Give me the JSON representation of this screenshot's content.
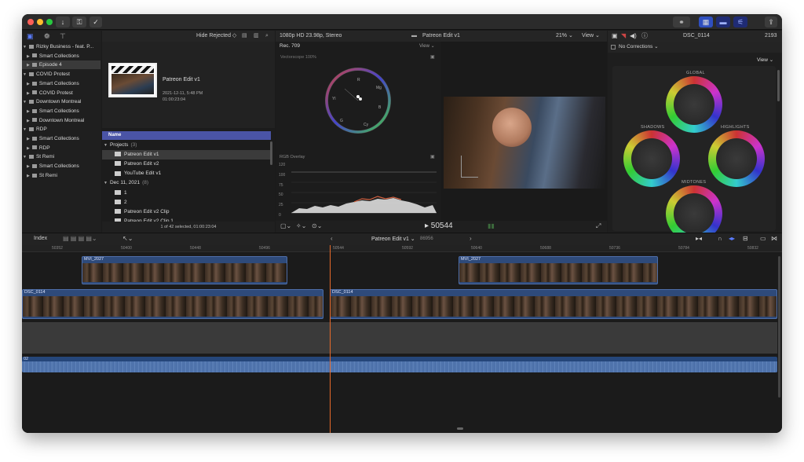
{
  "toolbar": {
    "hide_rejected": "Hide Rejected ◇"
  },
  "libraries": [
    {
      "label": "Rizky Business - feat. P...",
      "kind": "library",
      "indent": 0,
      "selected": false
    },
    {
      "label": "Smart Collections",
      "kind": "folder",
      "indent": 1,
      "selected": false
    },
    {
      "label": "Episode 4",
      "kind": "event",
      "indent": 1,
      "selected": true
    },
    {
      "label": "COVID Protest",
      "kind": "library",
      "indent": 0,
      "selected": false
    },
    {
      "label": "Smart Collections",
      "kind": "folder",
      "indent": 1,
      "selected": false
    },
    {
      "label": "COVID Protest",
      "kind": "event",
      "indent": 1,
      "selected": false
    },
    {
      "label": "Downtown Montreal",
      "kind": "library",
      "indent": 0,
      "selected": false
    },
    {
      "label": "Smart Collections",
      "kind": "folder",
      "indent": 1,
      "selected": false
    },
    {
      "label": "Downtown Montreal",
      "kind": "event",
      "indent": 1,
      "selected": false
    },
    {
      "label": "RDP",
      "kind": "library",
      "indent": 0,
      "selected": false
    },
    {
      "label": "Smart Collections",
      "kind": "folder",
      "indent": 1,
      "selected": false
    },
    {
      "label": "RDP",
      "kind": "event",
      "indent": 1,
      "selected": false
    },
    {
      "label": "St Remi",
      "kind": "library",
      "indent": 0,
      "selected": false
    },
    {
      "label": "Smart Collections",
      "kind": "folder",
      "indent": 1,
      "selected": false
    },
    {
      "label": "St Remi",
      "kind": "event",
      "indent": 1,
      "selected": false
    }
  ],
  "browser": {
    "preview_title": "Patreon Edit v1",
    "preview_date": "2021-12-11, 5:48 PM",
    "preview_duration": "01:00:23:04",
    "column_name": "Name",
    "rows": [
      {
        "label": "Projects",
        "count": "(3)",
        "type": "group",
        "selected": false
      },
      {
        "label": "Patreon Edit v1",
        "count": "",
        "type": "project",
        "selected": true
      },
      {
        "label": "Patreon Edit v2",
        "count": "",
        "type": "project",
        "selected": false
      },
      {
        "label": "YouTube Edit v1",
        "count": "",
        "type": "project",
        "selected": false
      },
      {
        "label": "Dec 11, 2021",
        "count": "(8)",
        "type": "group",
        "selected": false
      },
      {
        "label": "1",
        "count": "",
        "type": "clip",
        "selected": false
      },
      {
        "label": "2",
        "count": "",
        "type": "clip",
        "selected": false
      },
      {
        "label": "Patreon Edit v2 Clip",
        "count": "",
        "type": "clip",
        "selected": false
      },
      {
        "label": "Patreon Edit v2 Clip 1",
        "count": "",
        "type": "clip",
        "selected": false
      }
    ],
    "footer": "1 of 42 selected, 01:00:23:04"
  },
  "scopes": {
    "format": "1080p HD 23.98p, Stereo",
    "color_space": "Rec. 709",
    "view_menu": "View ⌄",
    "vectorscope_label": "Vectorscope",
    "vectorscope_pct": "100%",
    "rgb_label": "RGB Overlay",
    "y_ticks": [
      "120",
      "100",
      "75",
      "50",
      "25",
      "0",
      "-20"
    ],
    "vector_labels": [
      "R",
      "Mg",
      "B",
      "Cy",
      "G",
      "Yl"
    ]
  },
  "viewer": {
    "project_title": "Patreon Edit v1",
    "zoom": "21% ⌄",
    "view_menu": "View ⌄",
    "timecode": "▸ 50544"
  },
  "inspector": {
    "clip_name": "DSC_0114",
    "frame_count": "2193",
    "corrections": "No Corrections ⌄",
    "view_menu": "View ⌄",
    "wheels": [
      "GLOBAL",
      "SHADOWS",
      "HIGHLIGHTS",
      "MIDTONES"
    ]
  },
  "timeline": {
    "index_label": "Index",
    "project_title": "Patreon Edit v1 ⌄",
    "project_frames": "86956",
    "ruler_ticks": [
      "50352",
      "50400",
      "50448",
      "50496",
      "50544",
      "50592",
      "50640",
      "50688",
      "50736",
      "50784",
      "50832"
    ],
    "clips": [
      {
        "name": "MVI_2027",
        "lane": "connected"
      },
      {
        "name": "MVI_2027",
        "lane": "connected"
      },
      {
        "name": "DSC_0114",
        "lane": "primary"
      },
      {
        "name": "DSC_0114",
        "lane": "primary"
      },
      {
        "name": "02",
        "lane": "audio"
      }
    ]
  },
  "colors": {
    "accent": "#2f4fbf",
    "playhead": "#e86a2a",
    "clip": "#2e4a7a",
    "selection": "#4a54a6"
  }
}
